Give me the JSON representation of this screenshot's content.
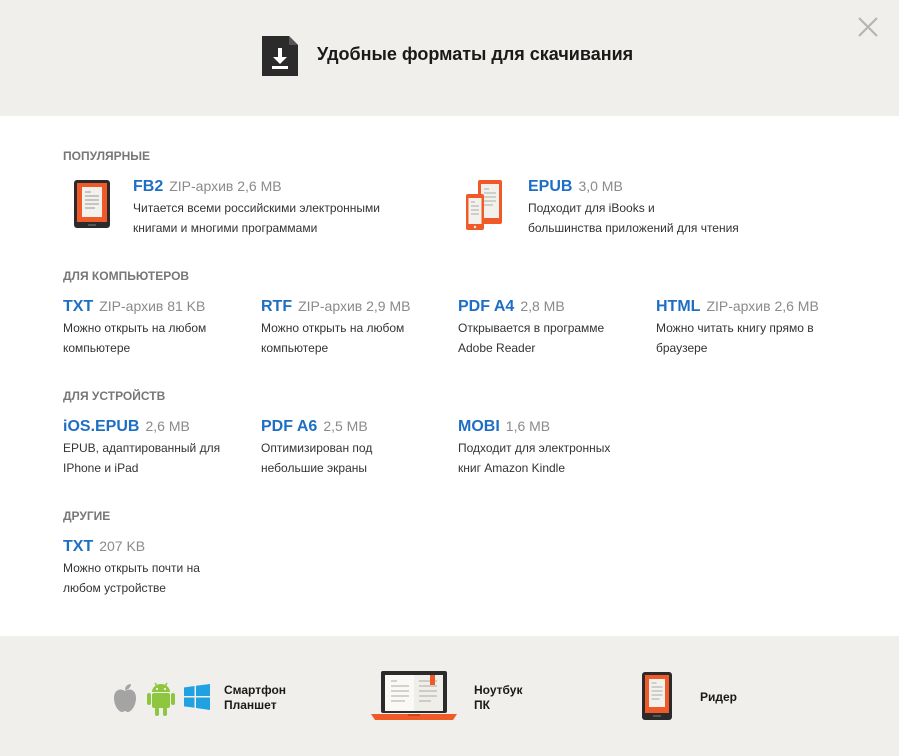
{
  "header": {
    "title": "Удобные форматы для скачивания"
  },
  "sections": {
    "popular": "Популярные",
    "computers": "Для компьютеров",
    "devices": "Для устройств",
    "other": "Другие"
  },
  "formats": {
    "fb2": {
      "name": "FB2",
      "size": "ZIP-архив 2,6 MB",
      "desc1": "Читается всеми российскими электронными",
      "desc2": "книгами и многими программами"
    },
    "epub": {
      "name": "EPUB",
      "size": "3,0 MB",
      "desc1": "Подходит для iBooks и",
      "desc2": "большинства приложений для чтения"
    },
    "txt_zip": {
      "name": "TXT",
      "size": "ZIP-архив 81 KB",
      "desc1": "Можно открыть на любом",
      "desc2": "компьютере"
    },
    "rtf": {
      "name": "RTF",
      "size": "ZIP-архив 2,9 MB",
      "desc1": "Можно открыть на любом",
      "desc2": "компьютере"
    },
    "pdf_a4": {
      "name": "PDF A4",
      "size": "2,8 MB",
      "desc1": "Открывается в программе",
      "desc2": "Adobe Reader"
    },
    "html": {
      "name": "HTML",
      "size": "ZIP-архив 2,6 MB",
      "desc1": "Можно читать книгу прямо в",
      "desc2": "браузере"
    },
    "ios_epub": {
      "name": "iOS.EPUB",
      "size": "2,6 MB",
      "desc1": "EPUB, адаптированный для",
      "desc2": "IPhone и iPad"
    },
    "pdf_a6": {
      "name": "PDF A6",
      "size": "2,5 MB",
      "desc1": "Оптимизирован под",
      "desc2": "небольшие экраны"
    },
    "mobi": {
      "name": "MOBI",
      "size": "1,6 MB",
      "desc1": "Подходит для электронных",
      "desc2": "книг Amazon Kindle"
    },
    "txt": {
      "name": "TXT",
      "size": "207 KB",
      "desc1": "Можно открыть почти на",
      "desc2": "любом устройстве"
    }
  },
  "footer": {
    "phone_line1": "Смартфон",
    "phone_line2": "Планшет",
    "laptop_line1": "Ноутбук",
    "laptop_line2": "ПК",
    "reader": "Ридер"
  },
  "colors": {
    "accent_orange": "#f05a28",
    "link_blue": "#1e6fc4",
    "header_bg": "#f0efeb"
  }
}
